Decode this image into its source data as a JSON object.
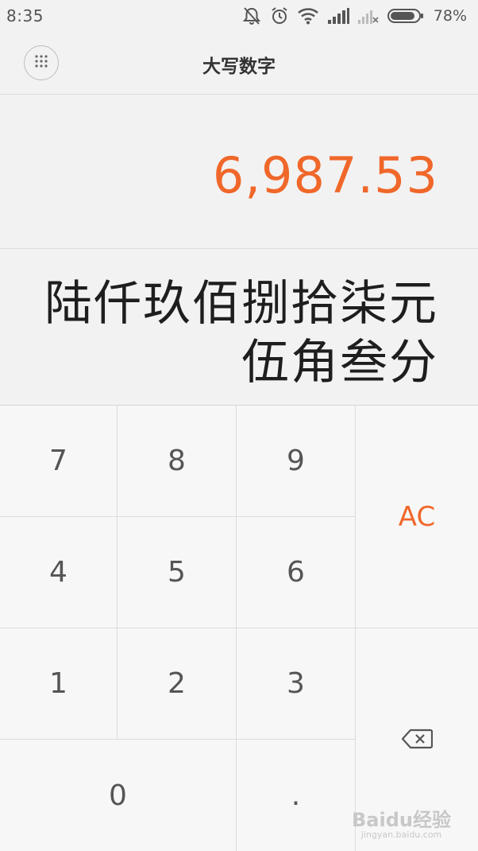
{
  "status_bar": {
    "time": "8:35",
    "battery_percent": "78%",
    "icons": [
      "mute-icon",
      "alarm-icon",
      "wifi-icon",
      "signal-icon",
      "no-signal-icon",
      "battery-icon"
    ]
  },
  "header": {
    "title": "大写数字",
    "menu_icon": "grid-dots-icon"
  },
  "display": {
    "number": "6,987.53",
    "result_line1": "陆仟玖佰捌拾柒元",
    "result_line2": "伍角叁分"
  },
  "keypad": {
    "keys": {
      "k7": "7",
      "k8": "8",
      "k9": "9",
      "k4": "4",
      "k5": "5",
      "k6": "6",
      "k1": "1",
      "k2": "2",
      "k3": "3",
      "k0": "0",
      "dot": ".",
      "ac": "AC"
    },
    "backspace_icon": "backspace-icon"
  },
  "watermark": {
    "brand": "Baidu经验",
    "url": "jingyan.baidu.com"
  },
  "colors": {
    "accent": "#f0672a",
    "background": "#f2f2f2",
    "keypad": "#f7f7f7",
    "text": "#1e1e1e"
  }
}
